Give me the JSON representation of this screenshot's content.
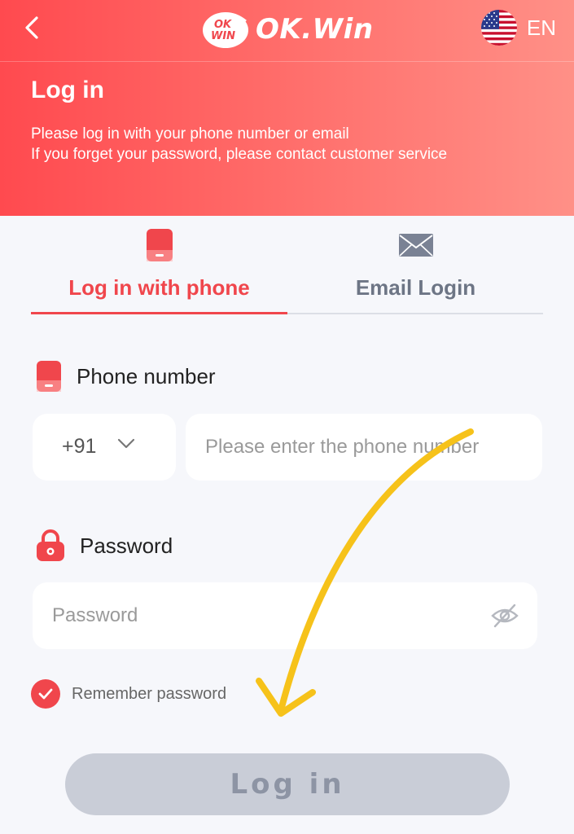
{
  "header": {
    "logo_text": "OK.Win",
    "logo_badge_top": "OK",
    "logo_badge_bottom": "WIN",
    "language": "EN"
  },
  "intro": {
    "title": "Log in",
    "line1": "Please log in with your phone number or email",
    "line2": "If you forget your password, please contact customer service"
  },
  "tabs": [
    {
      "label": "Log in with phone",
      "icon": "phone-icon",
      "active": true
    },
    {
      "label": "Email Login",
      "icon": "envelope-icon",
      "active": false
    }
  ],
  "phone": {
    "label": "Phone number",
    "country_code": "+91",
    "placeholder": "Please enter the phone number",
    "value": ""
  },
  "password": {
    "label": "Password",
    "placeholder": "Password",
    "value": ""
  },
  "remember": {
    "label": "Remember password",
    "checked": true
  },
  "login_button": "Log in",
  "colors": {
    "brand_red": "#f0464c",
    "hero_gradient_start": "#ff4a4f",
    "hero_gradient_end": "#ff9087",
    "button_disabled": "#c9cdd7",
    "annotation_arrow": "#f6c21a"
  }
}
